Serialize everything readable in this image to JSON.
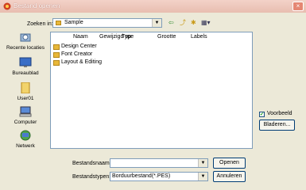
{
  "window": {
    "title": "Bestand openen",
    "close_glyph": "×"
  },
  "lookin": {
    "label": "Zoeken in:",
    "value": "Sample",
    "dropdown_glyph": "▼"
  },
  "toolbar": {
    "back_glyph": "⇦",
    "up_glyph": "⤴",
    "newfolder_glyph": "✱",
    "view_glyph": "▦▾"
  },
  "places": [
    {
      "label": "Recente locaties"
    },
    {
      "label": "Bureaublad"
    },
    {
      "label": "User01"
    },
    {
      "label": "Computer"
    },
    {
      "label": "Netwerk"
    }
  ],
  "filelist": {
    "columns": [
      "Naam",
      "Gewijzigd op",
      "Type",
      "Grootte",
      "Labels"
    ],
    "items": [
      "Design Center",
      "Font Creator",
      "Layout & Editing"
    ]
  },
  "preview": {
    "label": "Voorbeeld",
    "checked_glyph": "✔",
    "browse_label": "Bladeren..."
  },
  "filename": {
    "label": "Bestandsnaam:",
    "value": ""
  },
  "filetype": {
    "label": "Bestandstypen:",
    "value": "Borduurbestand(*.PES)"
  },
  "buttons": {
    "open": "Openen",
    "cancel": "Annuleren"
  }
}
